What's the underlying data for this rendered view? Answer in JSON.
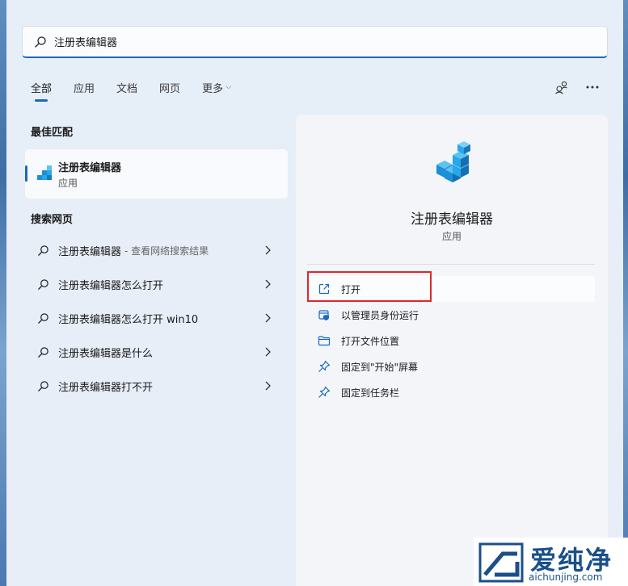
{
  "search": {
    "value": "注册表编辑器"
  },
  "tabs": [
    {
      "label": "全部",
      "active": true
    },
    {
      "label": "应用"
    },
    {
      "label": "文档"
    },
    {
      "label": "网页"
    },
    {
      "label": "更多"
    }
  ],
  "sections": {
    "best_match": "最佳匹配",
    "web_search": "搜索网页"
  },
  "best_match": {
    "name": "注册表编辑器",
    "type": "应用"
  },
  "web_results": [
    {
      "text": "注册表编辑器",
      "suffix": "- 查看网络搜索结果"
    },
    {
      "text": "注册表编辑器怎么打开",
      "suffix": ""
    },
    {
      "text": "注册表编辑器怎么打开 win10",
      "suffix": ""
    },
    {
      "text": "注册表编辑器是什么",
      "suffix": ""
    },
    {
      "text": "注册表编辑器打不开",
      "suffix": ""
    }
  ],
  "detail": {
    "title": "注册表编辑器",
    "subtitle": "应用",
    "actions": [
      {
        "label": "打开",
        "icon": "open-external-icon"
      },
      {
        "label": "以管理员身份运行",
        "icon": "shield-admin-icon"
      },
      {
        "label": "打开文件位置",
        "icon": "folder-icon"
      },
      {
        "label": "固定到\"开始\"屏幕",
        "icon": "pin-icon"
      },
      {
        "label": "固定到任务栏",
        "icon": "pin-icon"
      }
    ]
  },
  "watermark": {
    "brand": "爱纯净",
    "domain": "aichunjing.com"
  },
  "colors": {
    "accent": "#1a67c5",
    "highlight": "#e0262d",
    "icon_blue": "#1d8fd8"
  }
}
